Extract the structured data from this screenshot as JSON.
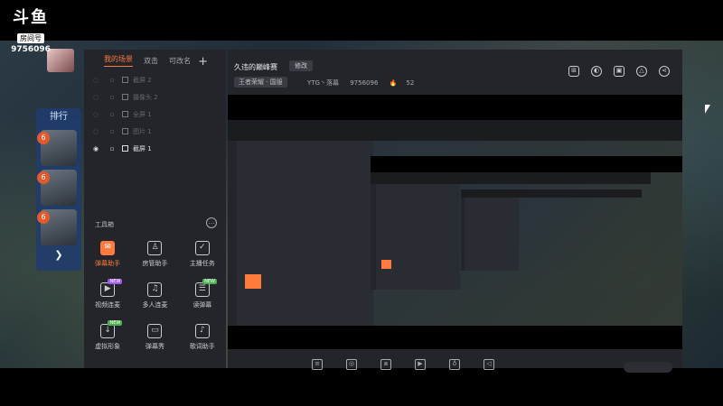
{
  "logo": {
    "mark": "斗鱼",
    "room_label": "房间号",
    "room_id": "9756096"
  },
  "rank": {
    "title": "排行",
    "badges": [
      "6",
      "6",
      "6"
    ]
  },
  "scenes": {
    "tabs": [
      {
        "label": "我的场景",
        "active": true
      },
      {
        "label": "双击",
        "active": false
      },
      {
        "label": "可改名",
        "active": false
      }
    ],
    "add_icon": "plus-icon",
    "items": [
      {
        "label": "截屏 2",
        "visible": false
      },
      {
        "label": "摄像头 2",
        "visible": false
      },
      {
        "label": "全屏 1",
        "visible": false
      },
      {
        "label": "图片 1",
        "visible": false
      },
      {
        "label": "截屏 1",
        "visible": true
      }
    ]
  },
  "toolbox": {
    "title": "工具箱",
    "tools": [
      {
        "label": "弹幕助手",
        "icon": "danmaku-helper-icon",
        "active": true,
        "badge": ""
      },
      {
        "label": "房管助手",
        "icon": "room-admin-icon",
        "active": false,
        "badge": ""
      },
      {
        "label": "主播任务",
        "icon": "streamer-task-icon",
        "active": false,
        "badge": ""
      },
      {
        "label": "视频连麦",
        "icon": "video-link-icon",
        "active": false,
        "badge": "NEW"
      },
      {
        "label": "多人连麦",
        "icon": "multi-link-icon",
        "active": false,
        "badge": ""
      },
      {
        "label": "读弹幕",
        "icon": "read-danmaku-icon",
        "active": false,
        "badge": "NEW"
      },
      {
        "label": "虚拟形象",
        "icon": "avatar-icon",
        "active": false,
        "badge": "NEW"
      },
      {
        "label": "弹幕秀",
        "icon": "danmaku-show-icon",
        "active": false,
        "badge": ""
      },
      {
        "label": "歌词助手",
        "icon": "lyrics-icon",
        "active": false,
        "badge": ""
      }
    ]
  },
  "stream": {
    "title": "久违的巅峰赛",
    "edit_label": "修改",
    "category": "王者荣耀 · 国服",
    "channel": "YTG丶落幕",
    "room_id": "9756096",
    "heat": "52",
    "header_icons": [
      "gift-icon",
      "lock-icon",
      "layout-icon",
      "bell-icon",
      "share-icon"
    ]
  },
  "bottom_bar_icons": [
    "subtitle-icon",
    "record-icon",
    "clip-icon",
    "play-icon",
    "mic-icon",
    "volume-icon"
  ],
  "colors": {
    "accent": "#ff7a3d",
    "panel": "#23252b"
  }
}
